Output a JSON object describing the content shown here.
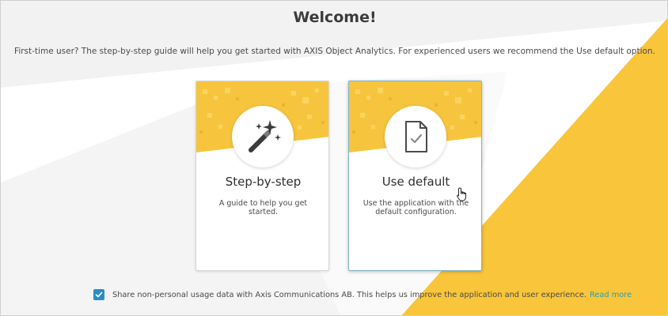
{
  "welcome": {
    "title": "Welcome!",
    "intro": "First-time user? The step-by-step guide will help you get started with AXIS Object Analytics. For experienced users we recommend the Use default option."
  },
  "cards": [
    {
      "title": "Step-by-step",
      "description": "A guide to help you get started.",
      "icon": "magic-wand-icon"
    },
    {
      "title": "Use default",
      "description": "Use the application with the default configuration.",
      "icon": "document-check-icon"
    }
  ],
  "consent": {
    "checked": true,
    "text": "Share non-personal usage data with Axis Communications AB. This helps us improve the application and user experience.",
    "link_text": "Read more"
  },
  "colors": {
    "accent_yellow": "#f9c53a",
    "checkbox_blue": "#2b8ec2",
    "link_teal": "#2aa0a8"
  }
}
